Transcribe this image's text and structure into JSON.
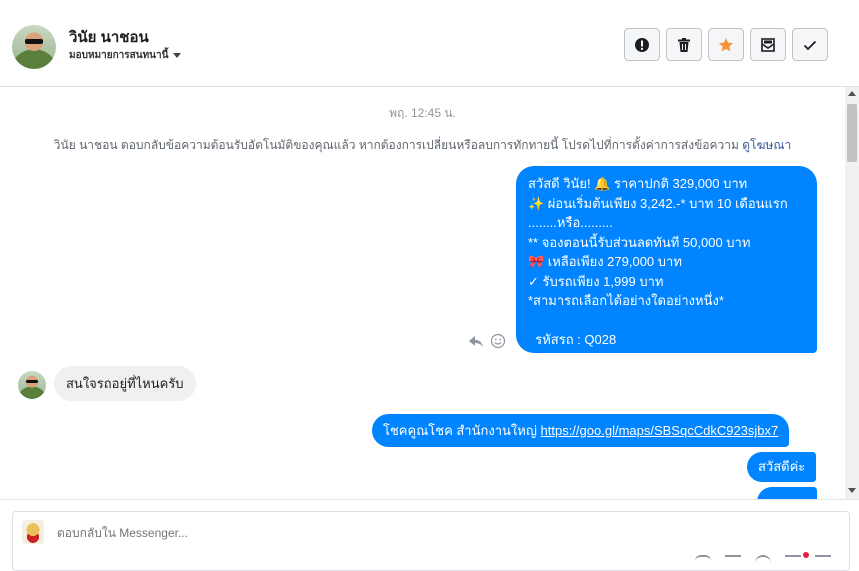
{
  "header": {
    "name": "วินัย นาชอน",
    "subtitle": "มอบหมายการสนทนานี้",
    "actions": [
      {
        "name": "report-button",
        "icon": "alert-icon"
      },
      {
        "name": "delete-button",
        "icon": "trash-icon"
      },
      {
        "name": "star-button",
        "icon": "star-icon",
        "color": "#f7923b"
      },
      {
        "name": "archive-button",
        "icon": "archive-envelope-icon"
      },
      {
        "name": "done-button",
        "icon": "checkmark-icon"
      }
    ]
  },
  "conversation": {
    "timestamp": "พฤ. 12:45 น.",
    "notice_text": "วินัย นาชอน ตอบกลับข้อความต้อนรับอัตโนมัติของคุณแล้ว หากต้องการเปลี่ยนหรือลบการทักทายนี้ โปรดไปที่การตั้งค่าการส่งข้อความ",
    "notice_link": "ดูโฆษณา",
    "outgoing_main_lines": [
      "สวัสดี วินัย! 🔔  ราคาปกติ 329,000 บาท",
      "✨  ผ่อนเริ่มต้นเพียง 3,242.-* บาท 10 เดือนแรก",
      "........หรือ.........",
      "** จองตอนนี้รับส่วนลดทันที 50,000 บาท",
      "🎀  เหลือเพียง 279,000 บาท",
      "✓ รับรถเพียง 1,999 บาท",
      "*สามารถเลือกได้อย่างใดอย่างหนึ่ง*",
      "",
      "  รหัสรถ : Q028"
    ],
    "incoming_text": "สนใจรถอยู่ที่ไหนครับ",
    "link_message_prefix": "โชคคูณโชค สำนักงานใหญ่ ",
    "link_message_url": "https://goo.gl/maps/SBSqcCdkC923sjbx7",
    "greeting_message": "สวัสดีค่ะ"
  },
  "composer": {
    "placeholder": "ตอบกลับใน Messenger..."
  },
  "colors": {
    "outgoing_bubble": "#0084ff",
    "incoming_bubble": "#f1f0f0",
    "link": "#385898"
  }
}
